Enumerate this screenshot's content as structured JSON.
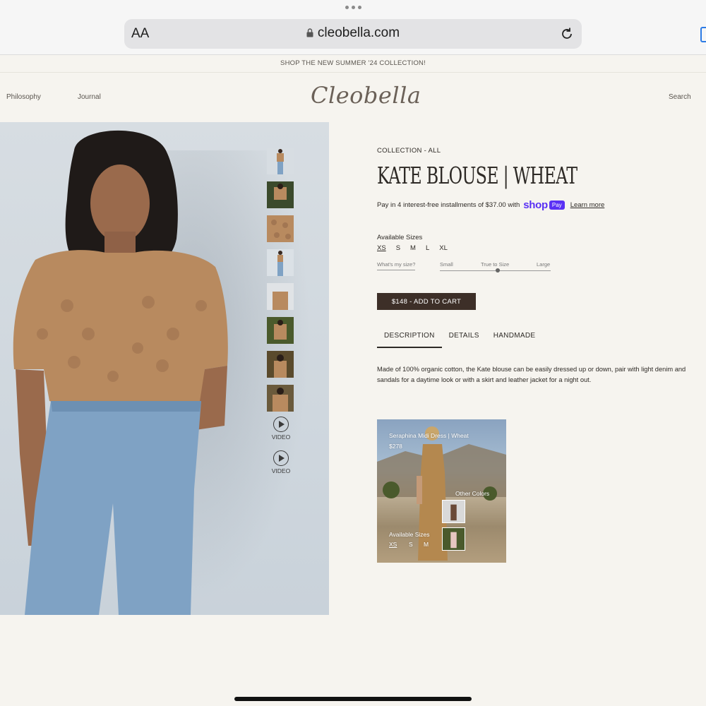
{
  "browser": {
    "text_size_label": "AA",
    "url": "cleobella.com"
  },
  "announcement": "SHOP THE NEW SUMMER '24 COLLECTION!",
  "nav": {
    "left": [
      "Philosophy",
      "Journal"
    ],
    "logo": "Cleobella",
    "right": "Search"
  },
  "gallery": {
    "thumbnail_count": 8,
    "videos": [
      "VIDEO",
      "VIDEO"
    ]
  },
  "product": {
    "breadcrumb": "COLLECTION - ALL",
    "title": "KATE BLOUSE | WHEAT",
    "installments_text": "Pay in 4 interest-free installments of $37.00 with",
    "shop_pay_word": "shop",
    "shop_pay_badge": "Pay",
    "learn_more": "Learn more",
    "sizes_label": "Available Sizes",
    "sizes": [
      "XS",
      "S",
      "M",
      "L",
      "XL"
    ],
    "selected_size": "XS",
    "fit": {
      "question": "What's my size?",
      "scale": [
        "Small",
        "True to Size",
        "Large"
      ],
      "level": 0.5
    },
    "add_to_cart": "$148  -  ADD TO CART",
    "tabs": [
      "DESCRIPTION",
      "DETAILS",
      "HANDMADE"
    ],
    "active_tab": "DESCRIPTION",
    "description": "Made of 100% organic cotton, the Kate blouse can be easily dressed up or down, pair with light denim and sandals for a daytime look or with a skirt and leather jacket for a night out."
  },
  "related": {
    "name": "Seraphina Midi Dress | Wheat",
    "price": "$278",
    "other_colors_label": "Other Colors",
    "sizes_label": "Available Sizes",
    "sizes": [
      "XS",
      "S",
      "M"
    ]
  },
  "colors": {
    "page_bg": "#f6f4ef",
    "cart_button": "#3d2f28",
    "shop_pay": "#5a31f4"
  }
}
